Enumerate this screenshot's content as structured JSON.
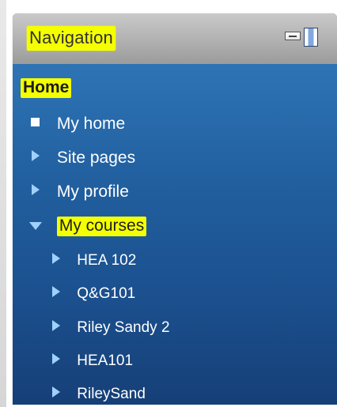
{
  "navigation": {
    "title": "Navigation",
    "items": {
      "home": "Home",
      "my_home": "My home",
      "site_pages": "Site pages",
      "my_profile": "My profile",
      "my_courses": "My courses",
      "courses": [
        "HEA 102",
        "Q&G101",
        "Riley Sandy 2",
        "HEA101",
        "RileySand"
      ]
    }
  },
  "icons": {
    "my_home": "square-bullet-icon",
    "collapsed": "chevron-right-icon",
    "expanded": "chevron-down-icon",
    "dock": "dock-icon",
    "hide": "hide-block-icon"
  },
  "colors": {
    "highlight": "#f4ff00",
    "nav_body_top": "#2e74b5",
    "nav_body_bottom": "#163f77",
    "arrow": "#9fd1ff"
  }
}
